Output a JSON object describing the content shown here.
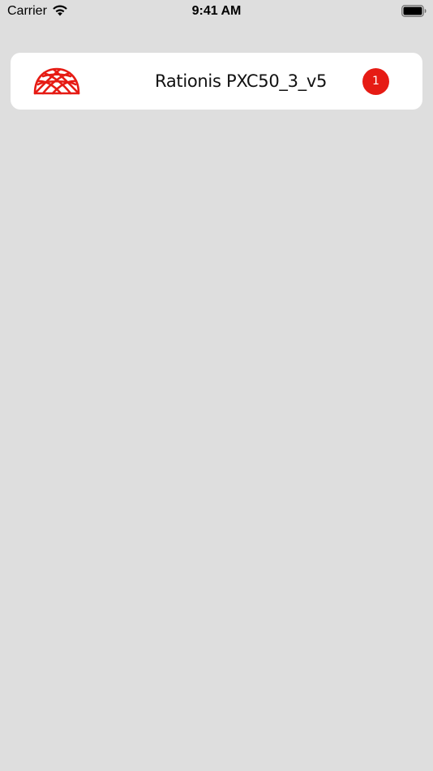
{
  "status_bar": {
    "carrier": "Carrier",
    "time": "9:41 AM",
    "wifi_icon": "wifi-icon",
    "battery_icon": "battery-icon"
  },
  "devices": [
    {
      "name": "Rationis PXC50_3_v5",
      "badge_count": "1",
      "logo_icon": "dome-grid-logo",
      "accent_color": "#e61b14"
    }
  ],
  "colors": {
    "background": "#dedede",
    "card": "#ffffff",
    "accent": "#e61b14"
  }
}
